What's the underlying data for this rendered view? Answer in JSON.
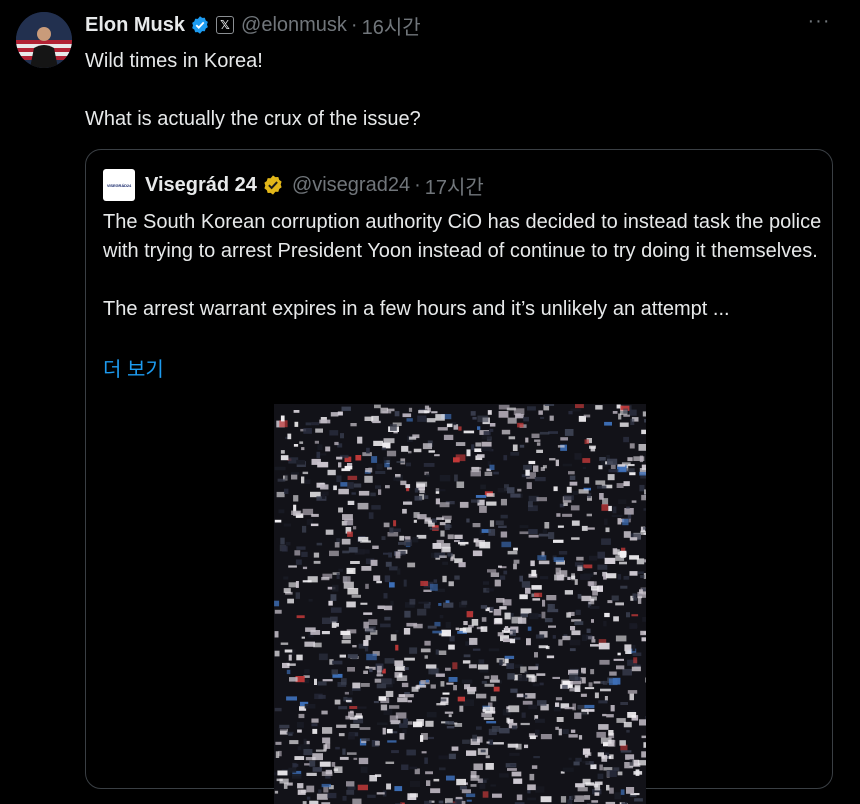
{
  "tweet": {
    "author_name": "Elon Musk",
    "handle": "@elonmusk",
    "separator": "·",
    "time": "16시간",
    "affiliate_badge": "𝕏",
    "text_line1": "Wild times in Korea!",
    "text_line2": "What is actually the crux of the issue?",
    "more_label": "···"
  },
  "quoted_tweet": {
    "avatar_text": "VISEGRÁD24",
    "author_name": "Visegrád 24",
    "handle": "@visegrad24",
    "separator": "·",
    "time": "17시간",
    "paragraph1": "The South Korean corruption authority CiO has decided to instead task the police with trying to arrest President Yoon instead of continue to try doing it themselves.",
    "paragraph2": "The arrest warrant expires in a few hours and it’s unlikely an attempt ...",
    "show_more": "더 보기"
  },
  "colors": {
    "background": "#000000",
    "text": "#e7e9ea",
    "muted": "#71767b",
    "link": "#1d9bf0",
    "verified_blue": "#1d9bf0",
    "verified_gold": "#e2b719"
  },
  "icons": {
    "verified": "verified-badge-icon",
    "affiliate": "x-logo-icon",
    "more": "more-icon"
  }
}
